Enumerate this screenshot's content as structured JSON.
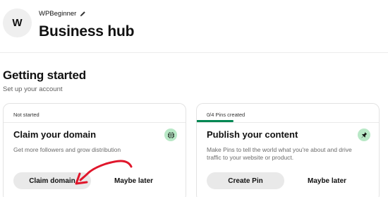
{
  "header": {
    "avatar_letter": "W",
    "account_name": "WPBeginner",
    "title": "Business hub"
  },
  "getting_started": {
    "title": "Getting started",
    "subtitle": "Set up your account"
  },
  "cards": [
    {
      "status": "Not started",
      "title": "Claim your domain",
      "description": "Get more followers and grow distribution",
      "primary_button": "Claim domain",
      "secondary_button": "Maybe later",
      "icon": "globe-icon",
      "progress": 0
    },
    {
      "status": "0/4 Pins created",
      "title": "Publish your content",
      "description": "Make Pins to tell the world what you're about and drive traffic to your website or product.",
      "primary_button": "Create Pin",
      "secondary_button": "Maybe later",
      "icon": "pin-icon",
      "progress": 0.2
    }
  ],
  "colors": {
    "progress": "#008753",
    "icon_bg": "#b8e8c6",
    "annotation": "#e0162b"
  }
}
